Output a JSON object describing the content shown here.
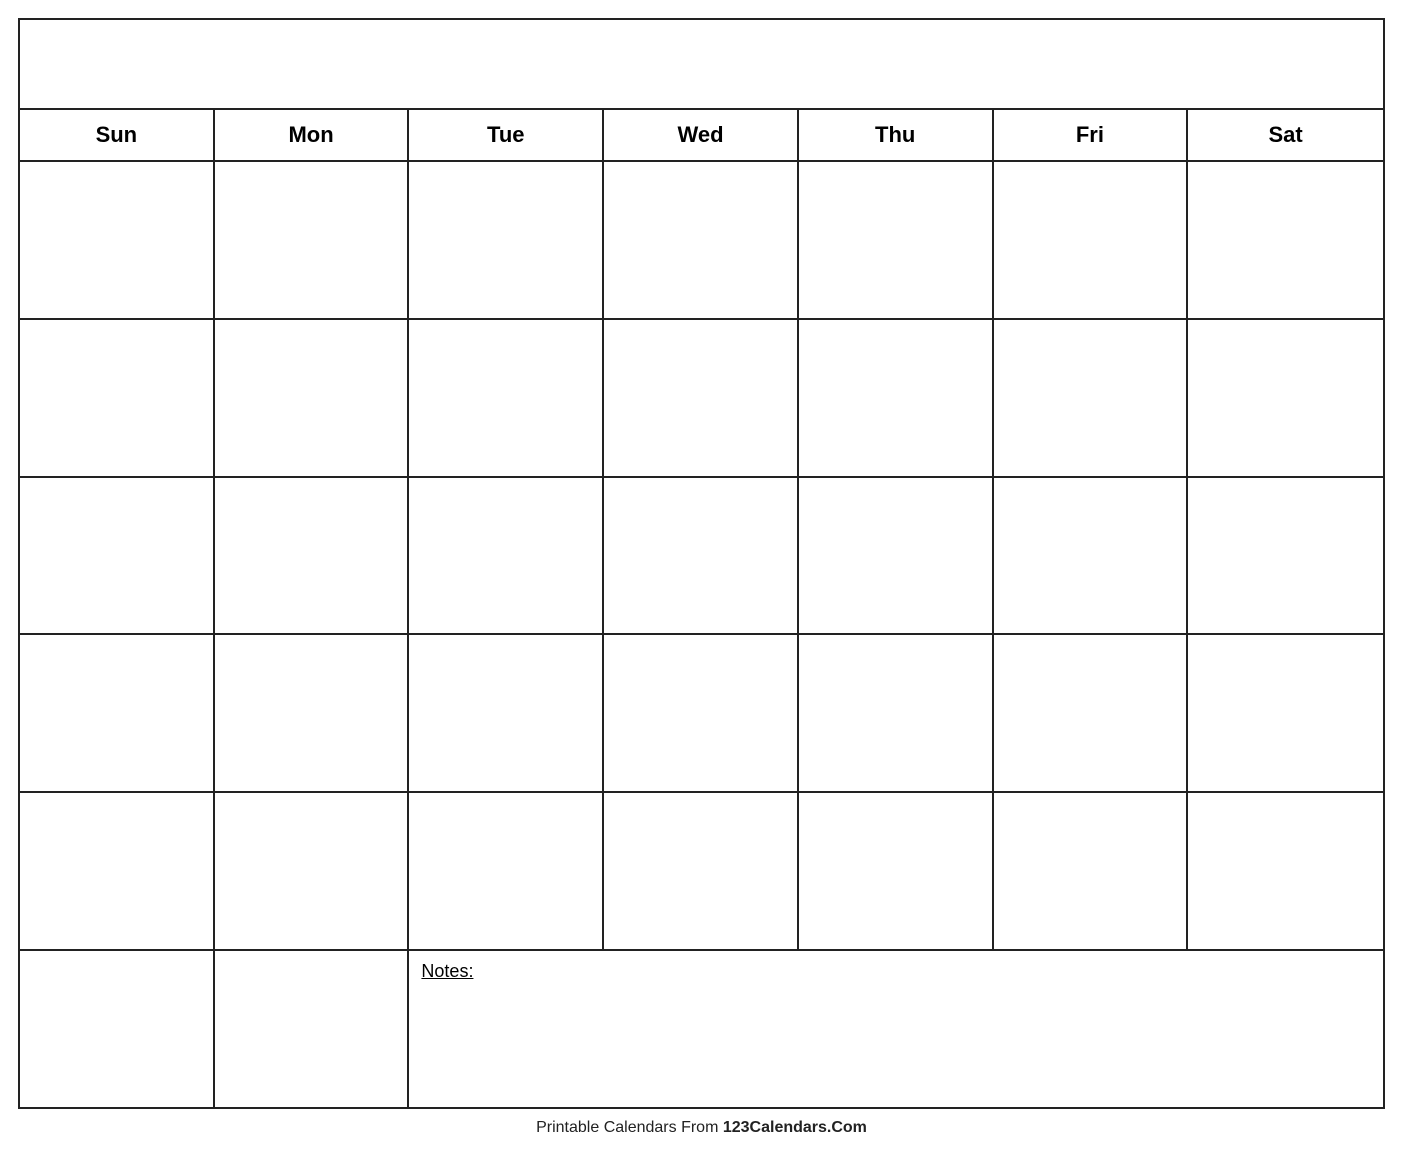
{
  "calendar": {
    "title": "",
    "days": [
      "Sun",
      "Mon",
      "Tue",
      "Wed",
      "Thu",
      "Fri",
      "Sat"
    ],
    "weeks": [
      [
        "",
        "",
        "",
        "",
        "",
        "",
        ""
      ],
      [
        "",
        "",
        "",
        "",
        "",
        "",
        ""
      ],
      [
        "",
        "",
        "",
        "",
        "",
        "",
        ""
      ],
      [
        "",
        "",
        "",
        "",
        "",
        "",
        ""
      ],
      [
        "",
        "",
        "",
        "",
        "",
        "",
        ""
      ]
    ],
    "notes_label": "Notes:"
  },
  "footer": {
    "text_normal": "Printable Calendars From ",
    "text_bold": "123Calendars.Com"
  }
}
